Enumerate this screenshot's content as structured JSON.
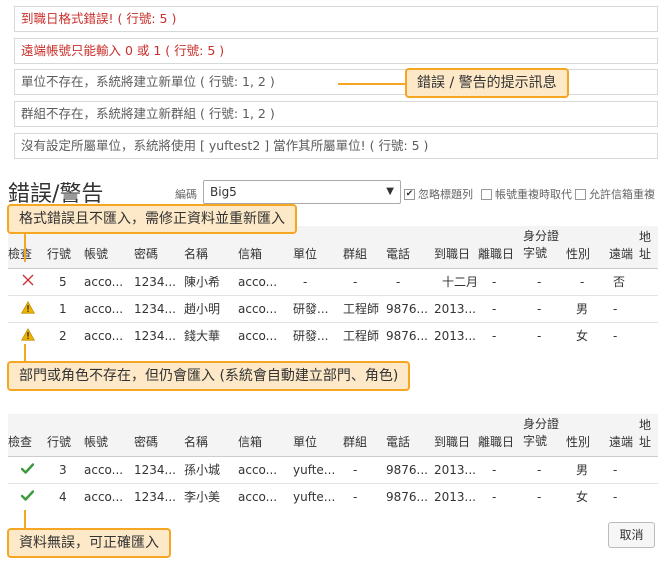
{
  "messages": [
    {
      "text": "到職日格式錯誤! ( 行號: 5 )",
      "kind": "err"
    },
    {
      "text": "遠端帳號只能輸入 0 或 1 ( 行號: 5 )",
      "kind": "err"
    },
    {
      "text": "單位不存在，系統將建立新單位 ( 行號: 1, 2 )",
      "kind": "warn"
    },
    {
      "text": "群組不存在，系統將建立新群組 ( 行號: 1, 2 )",
      "kind": "warn"
    },
    {
      "text": "沒有設定所屬單位，系統將使用 [ yuftest2 ] 當作其所屬單位! ( 行號: 5 )",
      "kind": "warn"
    }
  ],
  "callouts": {
    "messages_hint": "錯誤 / 警告的提示訊息",
    "format_error": "格式錯誤且不匯入，需修正資料並重新匯入",
    "warning_import": "部門或角色不存在，但仍會匯入 (系統會自動建立部門、角色)",
    "valid_import": "資料無誤，可正確匯入"
  },
  "errors_section": {
    "title": "錯誤/警告"
  },
  "toolbar": {
    "encoding_label": "編碼",
    "encoding_value": "Big5",
    "ignore_title_label": "忽略標題列",
    "ignore_title_checked": true,
    "overwrite_duplicate_label": "帳號重複時取代",
    "overwrite_duplicate_checked": false,
    "allow_duplicate_email_label": "允許信箱重複",
    "allow_duplicate_email_checked": false
  },
  "columns": [
    "檢查",
    "行號",
    "帳號",
    "密碼",
    "名稱",
    "信箱",
    "單位",
    "群組",
    "電話",
    "到職日",
    "離職日",
    "身分證\n字號",
    "性別",
    "遠端",
    "地址"
  ],
  "error_rows": [
    {
      "status": "error",
      "line": "5",
      "account": "acco...",
      "password": "1234...",
      "name": "陳小希",
      "email": "acco...",
      "unit": "-",
      "group": "-",
      "phone": "-",
      "hire_date": "十二月",
      "leave_date": "-",
      "id_no": "-",
      "gender": "-",
      "remote": "否",
      "address": ""
    },
    {
      "status": "warning",
      "line": "1",
      "account": "acco...",
      "password": "1234...",
      "name": "趙小明",
      "email": "acco...",
      "unit": "研發...",
      "group": "工程師",
      "phone": "9876...",
      "hire_date": "2013...",
      "leave_date": "-",
      "id_no": "-",
      "gender": "男",
      "remote": "-",
      "address": ""
    },
    {
      "status": "warning",
      "line": "2",
      "account": "acco...",
      "password": "1234...",
      "name": "錢大華",
      "email": "acco...",
      "unit": "研發...",
      "group": "工程師",
      "phone": "9876...",
      "hire_date": "2013...",
      "leave_date": "-",
      "id_no": "-",
      "gender": "女",
      "remote": "-",
      "address": ""
    }
  ],
  "valid_rows": [
    {
      "status": "ok",
      "line": "3",
      "account": "acco...",
      "password": "1234...",
      "name": "孫小城",
      "email": "acco...",
      "unit": "yufte...",
      "group": "-",
      "phone": "9876...",
      "hire_date": "2013...",
      "leave_date": "-",
      "id_no": "-",
      "gender": "男",
      "remote": "-",
      "address": ""
    },
    {
      "status": "ok",
      "line": "4",
      "account": "acco...",
      "password": "1234...",
      "name": "李小美",
      "email": "acco...",
      "unit": "yufte...",
      "group": "-",
      "phone": "9876...",
      "hire_date": "2013...",
      "leave_date": "-",
      "id_no": "-",
      "gender": "女",
      "remote": "-",
      "address": ""
    }
  ],
  "cancel_label": "取消",
  "colors": {
    "accent_callout": "#f5a623",
    "error": "#c9302c",
    "ok": "#3c9a3c",
    "warning": "#f0b400"
  }
}
